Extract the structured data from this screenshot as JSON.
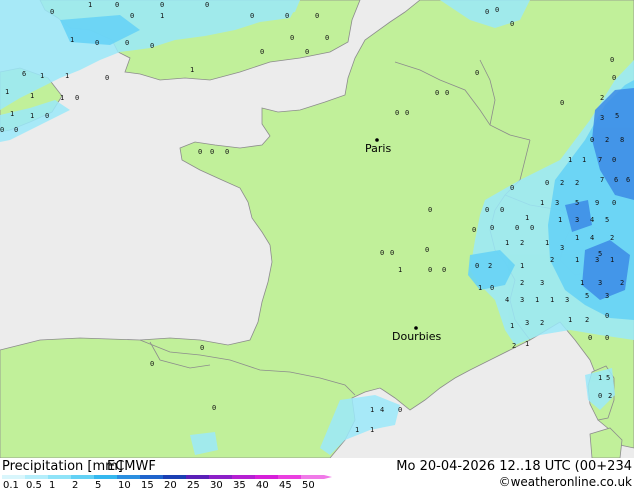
{
  "map": {
    "cities": [
      {
        "name": "Paris"
      },
      {
        "name": "Dourbies"
      }
    ],
    "colors": {
      "sea": "#ececec",
      "land": "#c1f09a",
      "border": "#8c8c8c",
      "precip_light": "#9be9fa",
      "precip_mid": "#67d3f6",
      "precip_heavy": "#3c8be6"
    }
  },
  "footer": {
    "title": "Precipitation [mm]",
    "model": "ECMWF",
    "valid_time": "Mo 20-04-2026 12..18 UTC (00+234",
    "credit": "©weatheronline.co.uk"
  },
  "legend": {
    "ticks": [
      "0.1",
      "0.5",
      "1",
      "2",
      "5",
      "10",
      "15",
      "20",
      "25",
      "30",
      "35",
      "40",
      "45",
      "50"
    ],
    "colors": [
      "#d9f6fc",
      "#b5eefb",
      "#8fe3f8",
      "#63d1f5",
      "#35b8ef",
      "#2b8fe0",
      "#1f64cc",
      "#1a3fb3",
      "#5a1fb8",
      "#8c1fc8",
      "#b51fd2",
      "#d61fd9",
      "#ea3fe0",
      "#f07ae8"
    ]
  }
}
